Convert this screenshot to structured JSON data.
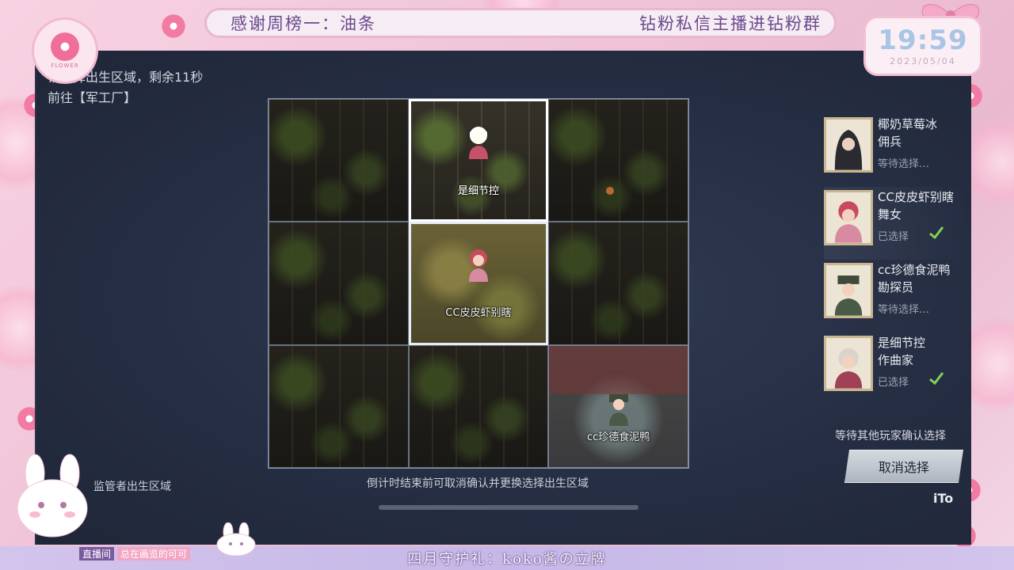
{
  "overlay": {
    "top_banner_left": "感谢周榜一：油条",
    "top_banner_right": "钻粉私信主播进钻粉群",
    "logo_text": "FLOWER",
    "clock_time": "19:59",
    "clock_date": "2023/05/04",
    "bottom_banner": "四月守护礼：koko酱の立牌",
    "live_tag_a": "直播间",
    "live_tag_b": "总在画览的可可"
  },
  "game": {
    "timer_text": "请选择出生区域，剩余11秒",
    "goto_text": "前往【军工厂】",
    "hunter_label": "监管者出生区域",
    "bottom_hint": "倒计时结束前可取消确认并更换选择出生区域",
    "cells": [
      {
        "label": ""
      },
      {
        "label": "是细节控"
      },
      {
        "label": ""
      },
      {
        "label": ""
      },
      {
        "label": "CC皮皮虾别瞎"
      },
      {
        "label": ""
      },
      {
        "label": ""
      },
      {
        "label": ""
      },
      {
        "label": "cc珍德食泥鸭"
      }
    ],
    "players": [
      {
        "name": "椰奶草莓冰",
        "role": "佣兵",
        "status": "等待选择…"
      },
      {
        "name": "CC皮皮虾别瞎",
        "role": "舞女",
        "status": "已选择"
      },
      {
        "name": "cc珍德食泥鸭",
        "role": "勘探员",
        "status": "等待选择…"
      },
      {
        "name": "是细节控",
        "role": "作曲家",
        "status": "已选择"
      }
    ],
    "wait_text": "等待其他玩家确认选择",
    "cancel_label": "取消选择",
    "brand": "iTo"
  },
  "colors": {
    "game_bg": "#252d42",
    "check_green": "#7fd35a",
    "banner_text": "#6b4a8c",
    "pink_frame": "#f0c3d8"
  }
}
